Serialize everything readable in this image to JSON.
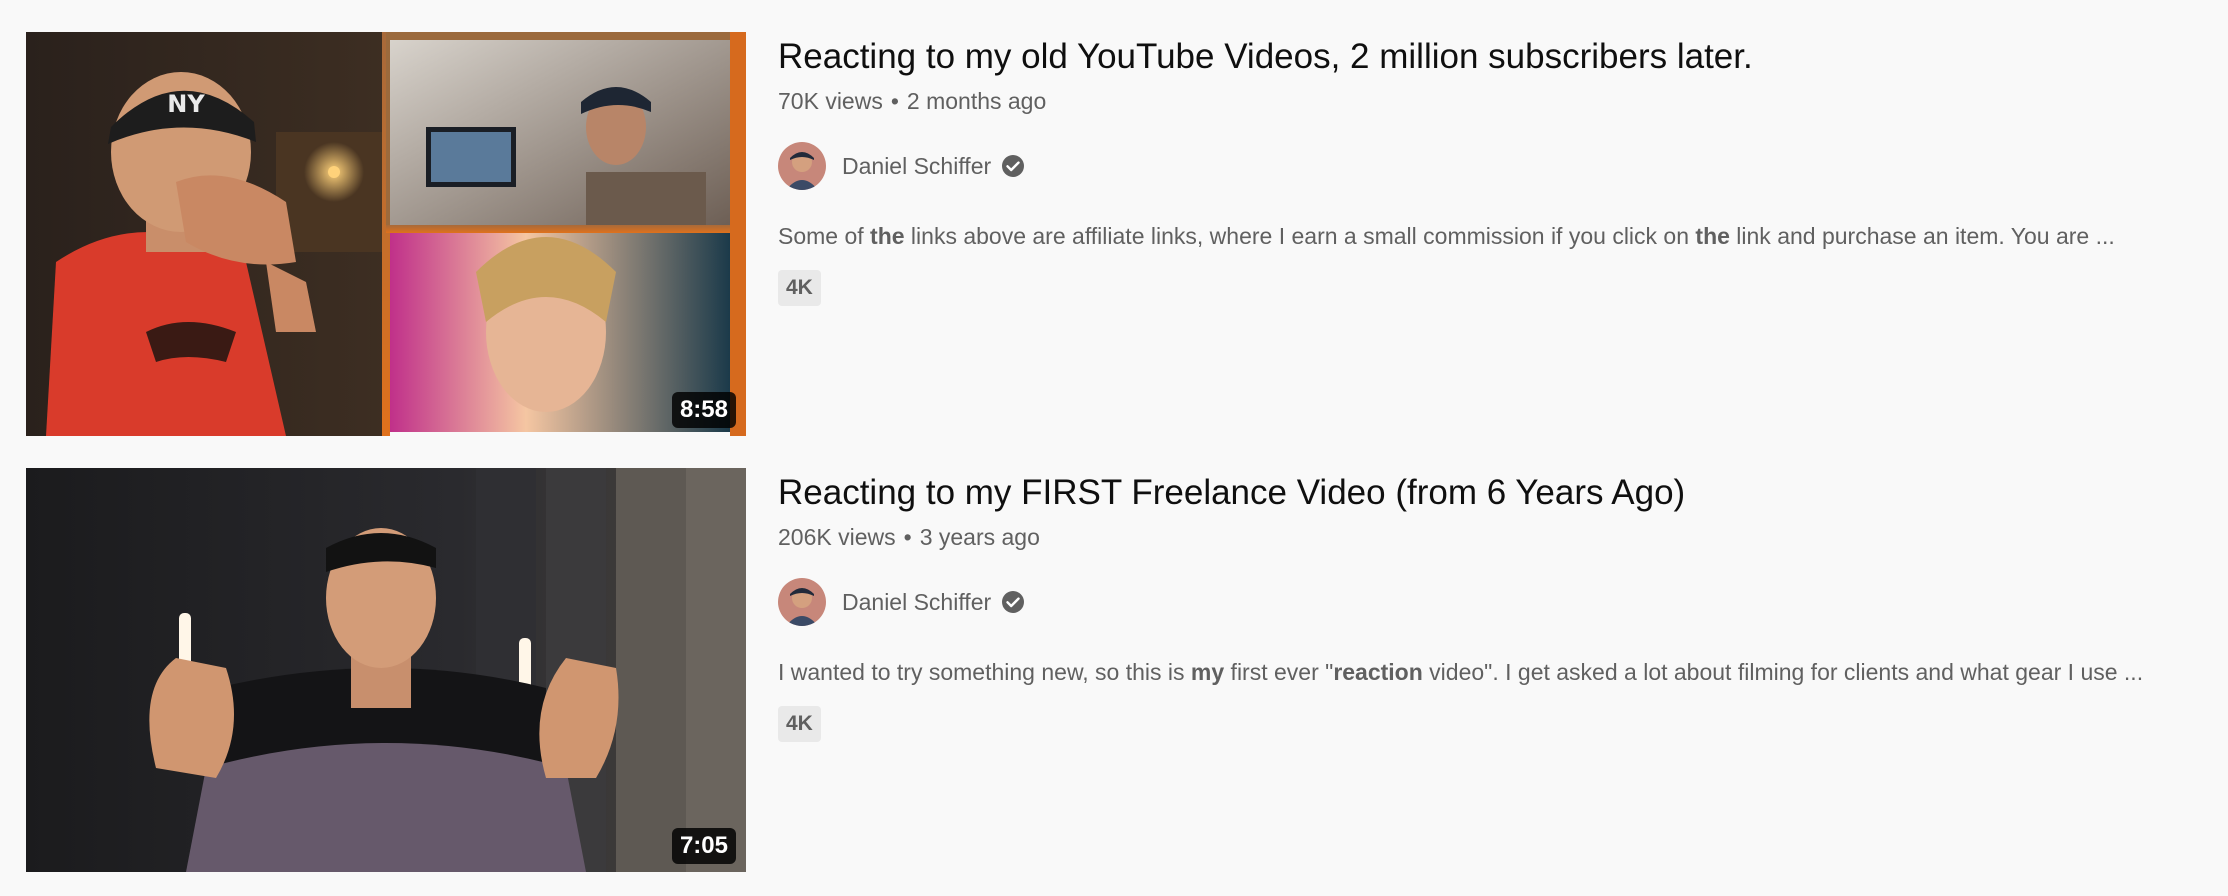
{
  "results": [
    {
      "title": "Reacting to my old YouTube Videos, 2 million subscribers later.",
      "views": "70K views",
      "age": "2 months ago",
      "channel": "Daniel Schiffer",
      "description_parts": [
        {
          "text": "Some of ",
          "bold": false
        },
        {
          "text": "the",
          "bold": true
        },
        {
          "text": " links above are affiliate links, where I earn a small commission if you click on ",
          "bold": false
        },
        {
          "text": "the",
          "bold": true
        },
        {
          "text": " link and purchase an item. You are ...",
          "bold": false
        }
      ],
      "badge": "4K",
      "duration": "8:58",
      "thumbnail_icon": "collage-thumbnail"
    },
    {
      "title": "Reacting to my FIRST Freelance Video (from 6 Years Ago)",
      "views": "206K views",
      "age": "3 years ago",
      "channel": "Daniel Schiffer",
      "description_parts": [
        {
          "text": "I wanted to try something new, so this is ",
          "bold": false
        },
        {
          "text": "my",
          "bold": true
        },
        {
          "text": " first ever \"",
          "bold": false
        },
        {
          "text": "reaction",
          "bold": true
        },
        {
          "text": " video\". I get asked a lot about filming for clients and what gear I use ...",
          "bold": false
        }
      ],
      "badge": "4K",
      "duration": "7:05",
      "thumbnail_icon": "shrug-thumbnail"
    }
  ],
  "meta_separator": "•",
  "colors": {
    "background": "#f9f9f9",
    "title": "#0f0f0f",
    "secondary": "#606060",
    "badge_bg": "#e9e9e9"
  }
}
